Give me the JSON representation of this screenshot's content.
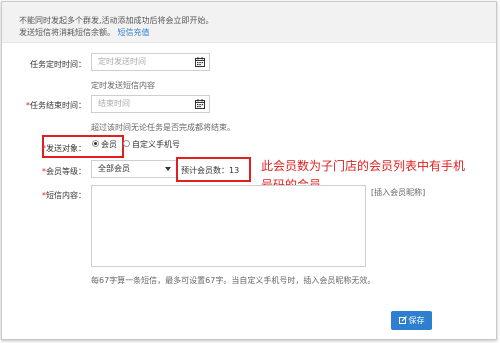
{
  "notice": {
    "line1": "不能同时发起多个群发,活动添加成功后将会立即开始。",
    "line2_prefix": "发送短信将消耗短信余额。",
    "line2_link": "短信充值"
  },
  "form": {
    "schedule_time": {
      "label": "任务定时时间：",
      "placeholder": "定时发送时间",
      "hint": "定时发送短信内容"
    },
    "end_time": {
      "required_mark": "*",
      "label": "任务结束时间：",
      "placeholder": "结束时间",
      "hint": "超过该时间无论任务是否完成都将结束。"
    },
    "send_target": {
      "required_mark": "*",
      "label": "发送对象：",
      "options": [
        {
          "label": "会员",
          "selected": true
        },
        {
          "label": "自定义手机号",
          "selected": false
        }
      ]
    },
    "member_level": {
      "required_mark": "*",
      "label": "会员等级：",
      "selected": "全部会员",
      "estimate_text": "预计会员数：13"
    },
    "sms_content": {
      "required_mark": "*",
      "label": "短信内容：",
      "insert_link": "[插入会员昵称]",
      "hint": "每67字算一条短信，最多可设置67字。当自定义手机号时，插入会员昵称无效。"
    }
  },
  "annotation": {
    "line1": "此会员数为子门店的会员列表中有手机",
    "line2": "号码的会员"
  },
  "save_button": {
    "label": "保存"
  },
  "colors": {
    "accent": "#2f7fd1",
    "annotation_red": "#e02020",
    "notice_bg": "#f2f2f2"
  }
}
